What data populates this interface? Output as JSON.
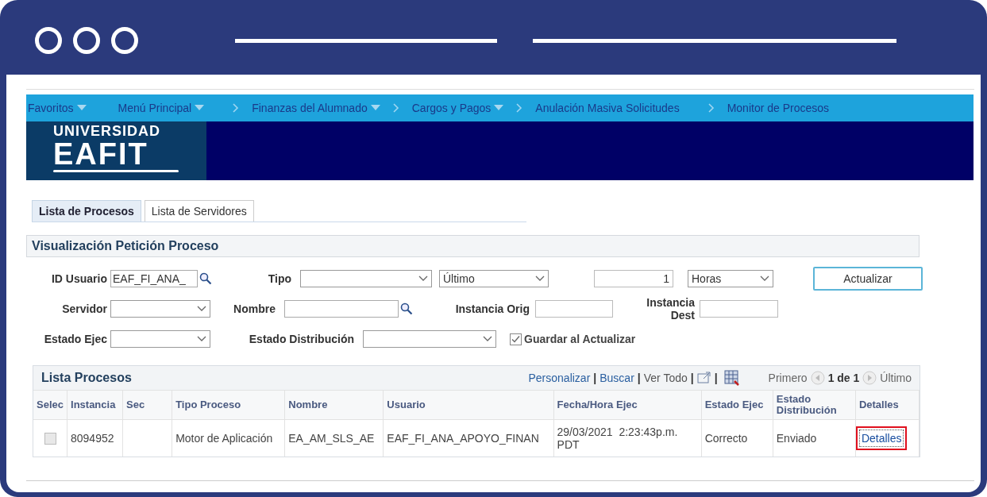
{
  "nav": [
    {
      "label": "Favoritos",
      "dropdown": true
    },
    {
      "label": "Menú Principal",
      "dropdown": true
    },
    {
      "label": "Finanzas del Alumnado",
      "dropdown": true
    },
    {
      "label": "Cargos y Pagos",
      "dropdown": true
    },
    {
      "label": "Anulación Masiva Solicitudes",
      "dropdown": false
    },
    {
      "label": "Monitor de Procesos",
      "dropdown": false
    }
  ],
  "logo": {
    "line_1": "UNIVERSIDAD",
    "line_2": "EAFIT"
  },
  "tabs": [
    {
      "label": "Lista de Procesos",
      "selected": true
    },
    {
      "label": "Lista de Servidores",
      "selected": false
    }
  ],
  "section_title": "Visualización Petición Proceso",
  "form_rows": [
    [
      {
        "kind": "label",
        "text": "ID Usuario"
      },
      {
        "kind": "lookup",
        "value": "EAF_FI_ANA_"
      },
      {
        "kind": "label",
        "text": "Tipo"
      },
      {
        "kind": "select"
      },
      {
        "kind": "select",
        "value": "Último"
      },
      {
        "kind": "number",
        "value": "1"
      },
      {
        "kind": "select",
        "value": "Horas"
      },
      {
        "kind": "button",
        "text": "Actualizar"
      }
    ],
    [
      {
        "kind": "label",
        "text": "Servidor"
      },
      {
        "kind": "select"
      },
      {
        "kind": "label",
        "text": "Nombre"
      },
      {
        "kind": "lookup"
      },
      {
        "kind": "label",
        "text": "Instancia Orig"
      },
      {
        "kind": "input"
      },
      {
        "kind": "label",
        "text": "Instancia Dest"
      },
      {
        "kind": "input"
      }
    ],
    [
      {
        "kind": "label",
        "text": "Estado Ejec"
      },
      {
        "kind": "select"
      },
      {
        "kind": "label",
        "text": "Estado Distribución"
      },
      {
        "kind": "select"
      },
      {
        "kind": "checkbox",
        "text": "Guardar al Actualizar",
        "checked": true
      }
    ]
  ],
  "grid": {
    "title": "Lista Procesos",
    "links": [
      "Personalizar",
      "Buscar"
    ],
    "view_all": "Ver Todo",
    "separator": "|",
    "first": "Primero",
    "page": "1 de 1",
    "last": "Último",
    "columns": [
      "Selec",
      "Instancia",
      "Sec",
      "Tipo Proceso",
      "Nombre",
      "Usuario",
      "Fecha/Hora Ejec",
      "Estado Ejec",
      "Estado Distribución",
      "Detalles"
    ],
    "rows": [
      {
        "checked": false,
        "instance": "8094952",
        "type": "Motor de Aplicación",
        "name": "EA_AM_SLS_AE",
        "user": "EAF_FI_ANA_APOYO_FINAN",
        "datetime": "29/03/2021  2:23:43p.m. PDT",
        "run_status": "Correcto",
        "dist_status": "Enviado",
        "details": "Detalles",
        "highlighted": true
      }
    ]
  }
}
